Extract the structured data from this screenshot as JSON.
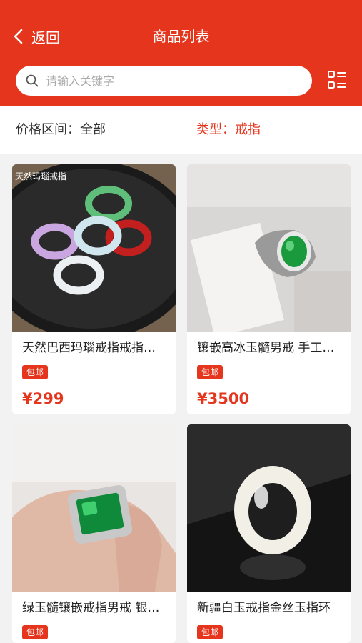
{
  "header": {
    "back_label": "返回",
    "title": "商品列表",
    "bg_color": "#e5351d"
  },
  "search": {
    "placeholder": "请输入关键字",
    "value": ""
  },
  "filters": {
    "price_label": "价格区间：全部",
    "type_label": "类型：戒指"
  },
  "products": [
    {
      "name": "天然巴西玛瑙戒指戒指女款玛瑙指环",
      "image_label": "天然玛瑙戒指",
      "tag": "包邮",
      "price": "¥299"
    },
    {
      "name": "镶嵌高冰玉髓男戒 手工银镶嵌",
      "tag": "包邮",
      "price": "¥3500"
    },
    {
      "name": "绿玉髓镶嵌戒指男戒 银镶嵌",
      "tag": "包邮",
      "price": ""
    },
    {
      "name": "新疆白玉戒指金丝玉指环",
      "tag": "包邮",
      "price": ""
    }
  ]
}
